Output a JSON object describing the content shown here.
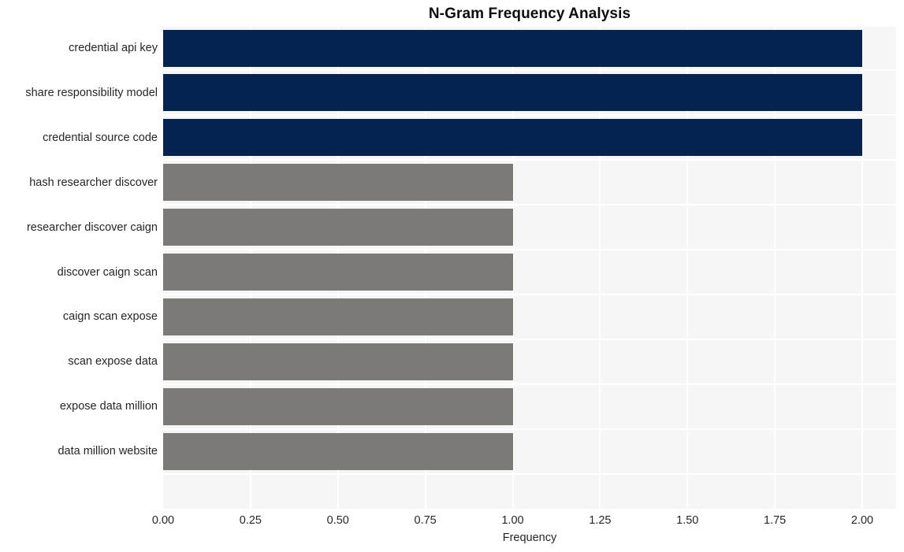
{
  "chart_data": {
    "type": "bar",
    "orientation": "horizontal",
    "title": "N-Gram Frequency Analysis",
    "xlabel": "Frequency",
    "ylabel": "",
    "xlim": [
      0,
      2.0
    ],
    "ylim": null,
    "grid": true,
    "legend": null,
    "xticks": [
      "0.00",
      "0.25",
      "0.50",
      "0.75",
      "1.00",
      "1.25",
      "1.50",
      "1.75",
      "2.00"
    ],
    "xtick_values": [
      0,
      0.25,
      0.5,
      0.75,
      1.0,
      1.25,
      1.5,
      1.75,
      2.0
    ],
    "categories": [
      "credential api key",
      "share responsibility model",
      "credential source code",
      "hash researcher discover",
      "researcher discover caign",
      "discover caign scan",
      "caign scan expose",
      "scan expose data",
      "expose data million",
      "data million website"
    ],
    "values": [
      2,
      2,
      2,
      1,
      1,
      1,
      1,
      1,
      1,
      1
    ],
    "bar_colors": [
      "#04244f",
      "#04244f",
      "#04244f",
      "#7b7a77",
      "#7b7a77",
      "#7b7a77",
      "#7b7a77",
      "#7b7a77",
      "#7b7a77",
      "#7b7a77"
    ],
    "plot_background": "#f6f6f7",
    "grid_color": "#ffffff",
    "text_color": "#262626",
    "title_color": "#0d0d0d"
  }
}
